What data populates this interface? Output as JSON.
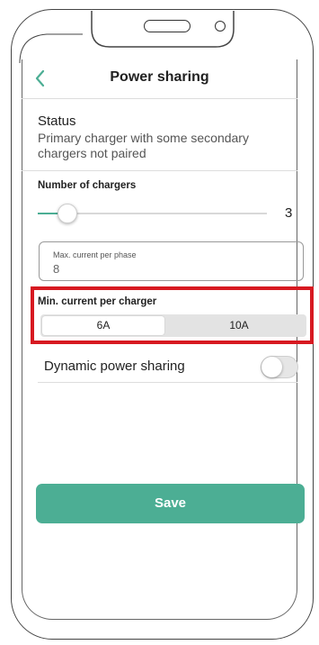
{
  "header": {
    "title": "Power sharing"
  },
  "status": {
    "label": "Status",
    "text": "Primary charger with some secondary chargers not paired"
  },
  "chargers": {
    "label": "Number of chargers",
    "value": "3",
    "slider_fraction": 0.13
  },
  "max_current": {
    "label": "Max. current per phase",
    "value": "8"
  },
  "min_current": {
    "label": "Min. current per charger",
    "options": [
      "6A",
      "10A"
    ],
    "selected": "6A"
  },
  "dynamic": {
    "label": "Dynamic power sharing",
    "enabled": false
  },
  "save_label": "Save",
  "colors": {
    "accent": "#4cae94",
    "highlight": "#d71921"
  }
}
